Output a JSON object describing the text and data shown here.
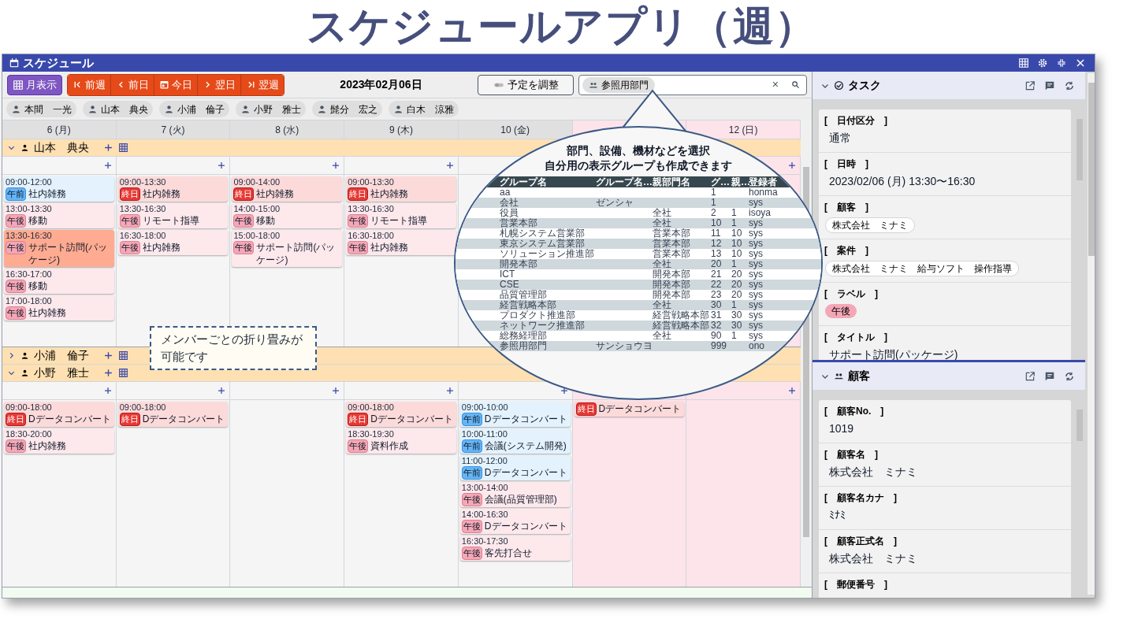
{
  "page_title": "スケジュールアプリ（週）",
  "window": {
    "title": "スケジュール"
  },
  "toolbar": {
    "month_button": "月表示",
    "nav_buttons": [
      {
        "label": "前週",
        "kind": "first"
      },
      {
        "label": "前日",
        "kind": "prev"
      },
      {
        "label": "今日",
        "kind": "today"
      },
      {
        "label": "翌日",
        "kind": "next"
      },
      {
        "label": "翌週",
        "kind": "last"
      }
    ],
    "date": "2023年02月06日",
    "adjust_button": "予定を調整",
    "search_chip": "参照用部門",
    "clear": "×"
  },
  "members": [
    "本間　一光",
    "山本　典央",
    "小浦　倫子",
    "小野　雅士",
    "髭分　宏之",
    "白木　涼雅"
  ],
  "days": [
    {
      "label": "6 (月)",
      "holiday": false
    },
    {
      "label": "7 (火)",
      "holiday": false
    },
    {
      "label": "8 (水)",
      "holiday": false
    },
    {
      "label": "9 (木)",
      "holiday": false
    },
    {
      "label": "10 (金)",
      "holiday": false
    },
    {
      "holiday": true
    },
    {
      "label": "12 (日)",
      "holiday": true
    }
  ],
  "groups": [
    {
      "name": "山本　典央",
      "expanded": true,
      "days": [
        {
          "holiday": false,
          "events": [
            {
              "time": "09:00-12:00",
              "label": "午前",
              "kind": "am",
              "title": "社内雑務",
              "selected": false
            },
            {
              "time": "13:00-13:30",
              "label": "午後",
              "kind": "pm",
              "title": "移動",
              "selected": false
            },
            {
              "time": "13:30-16:30",
              "label": "午後",
              "kind": "pm",
              "title": "サポート訪問(パッケージ)",
              "selected": true
            },
            {
              "time": "16:30-17:00",
              "label": "午後",
              "kind": "pm",
              "title": "移動",
              "selected": false
            },
            {
              "time": "17:00-18:00",
              "label": "午後",
              "kind": "pm",
              "title": "社内雑務",
              "selected": false
            }
          ]
        },
        {
          "holiday": false,
          "events": [
            {
              "time": "09:00-13:30",
              "label": "終日",
              "kind": "allday",
              "title": "社内雑務",
              "selected": false
            },
            {
              "time": "13:30-16:30",
              "label": "午後",
              "kind": "pm",
              "title": "リモート指導",
              "selected": false
            },
            {
              "time": "16:30-18:00",
              "label": "午後",
              "kind": "pm",
              "title": "社内雑務",
              "selected": false
            }
          ]
        },
        {
          "holiday": false,
          "events": [
            {
              "time": "09:00-14:00",
              "label": "終日",
              "kind": "allday",
              "title": "社内雑務",
              "selected": false
            },
            {
              "time": "14:00-15:00",
              "label": "午後",
              "kind": "pm",
              "title": "移動",
              "selected": false
            },
            {
              "time": "15:00-18:00",
              "label": "午後",
              "kind": "pm",
              "title": "サポート訪問(パッケージ)",
              "selected": false
            }
          ]
        },
        {
          "holiday": false,
          "events": [
            {
              "time": "09:00-13:30",
              "label": "終日",
              "kind": "allday",
              "title": "社内雑務",
              "selected": false
            },
            {
              "time": "13:30-16:30",
              "label": "午後",
              "kind": "pm",
              "title": "リモート指導",
              "selected": false
            },
            {
              "time": "16:30-18:00",
              "label": "午後",
              "kind": "pm",
              "title": "社内雑務",
              "selected": false
            }
          ]
        }
      ]
    },
    {
      "name": "小浦　倫子",
      "expanded": false
    },
    {
      "name": "小野　雅士",
      "expanded": true,
      "days": [
        {
          "holiday": false,
          "events": [
            {
              "time": "09:00-18:00",
              "label": "終日",
              "kind": "allday",
              "title": "Dデータコンバート",
              "selected": false
            },
            {
              "time": "18:30-20:00",
              "label": "午後",
              "kind": "pm",
              "title": "社内雑務",
              "selected": false
            }
          ]
        },
        {
          "holiday": false,
          "events": [
            {
              "time": "09:00-18:00",
              "label": "終日",
              "kind": "allday",
              "title": "Dデータコンバート",
              "selected": false
            }
          ]
        },
        {
          "holiday": false
        },
        {
          "holiday": false,
          "events": [
            {
              "time": "09:00-18:00",
              "label": "終日",
              "kind": "allday",
              "title": "Dデータコンバート",
              "selected": false
            },
            {
              "time": "18:30-19:30",
              "label": "午後",
              "kind": "pm",
              "title": "資料作成",
              "selected": false
            }
          ]
        },
        {
          "holiday": false,
          "events": [
            {
              "time": "09:00-10:00",
              "label": "午前",
              "kind": "am",
              "title": "Dデータコンバート",
              "selected": false
            },
            {
              "time": "10:00-11:00",
              "label": "午前",
              "kind": "am",
              "title": "会議(システム開発)",
              "selected": false
            },
            {
              "time": "11:00-12:00",
              "label": "午前",
              "kind": "am",
              "title": "Dデータコンバート",
              "selected": false
            },
            {
              "time": "13:00-14:00",
              "label": "午後",
              "kind": "pm",
              "title": "会議(品質管理部)",
              "selected": false
            },
            {
              "time": "14:00-16:30",
              "label": "午後",
              "kind": "pm",
              "title": "Dデータコンバート",
              "selected": false
            },
            {
              "time": "16:30-17:30",
              "label": "午後",
              "kind": "pm",
              "title": "客先打合せ",
              "selected": false
            }
          ]
        },
        {
          "holiday": true,
          "events": [
            {
              "label": "終日",
              "kind": "allday",
              "title": "Dデータコンバート",
              "selected": false
            }
          ]
        },
        {
          "holiday": true
        }
      ]
    }
  ],
  "note": "メンバーごとの折り畳みが可能です",
  "bubble": {
    "lines": [
      "部門、設備、機材などを選択",
      "自分用の表示グループも作成できます"
    ],
    "columns": [
      "グループ名",
      "グループ名…",
      "親部門名",
      "グ…",
      "親…",
      "登録者"
    ],
    "rows": [
      [
        "aa",
        "",
        "",
        "1",
        "",
        "honma"
      ],
      [
        "会社",
        "ゼンシャ",
        "",
        "1",
        "",
        "sys"
      ],
      [
        "役員",
        "",
        "全社",
        "2",
        "1",
        "isoya"
      ],
      [
        "営業本部",
        "",
        "全社",
        "10",
        "1",
        "sys"
      ],
      [
        "札幌システム営業部",
        "",
        "営業本部",
        "11",
        "10",
        "sys"
      ],
      [
        "東京システム営業部",
        "",
        "営業本部",
        "12",
        "10",
        "sys"
      ],
      [
        "ソリューション推進部",
        "",
        "営業本部",
        "13",
        "10",
        "sys"
      ],
      [
        "開発本部",
        "",
        "全社",
        "20",
        "1",
        "sys"
      ],
      [
        "ICT",
        "",
        "開発本部",
        "21",
        "20",
        "sys"
      ],
      [
        "CSE",
        "",
        "開発本部",
        "22",
        "20",
        "sys"
      ],
      [
        "品質管理部",
        "",
        "開発本部",
        "23",
        "20",
        "sys"
      ],
      [
        "経営戦略本部",
        "",
        "全社",
        "30",
        "1",
        "sys"
      ],
      [
        "プロダクト推進部",
        "",
        "経営戦略本部",
        "31",
        "30",
        "sys"
      ],
      [
        "ネットワーク推進部",
        "",
        "経営戦略本部",
        "32",
        "30",
        "sys"
      ],
      [
        "総務経理部",
        "",
        "全社",
        "90",
        "1",
        "sys"
      ],
      [
        "参照用部門",
        "サンショウヨ",
        "",
        "999",
        "",
        "ono"
      ]
    ]
  },
  "panels": [
    {
      "title": "タスク",
      "kind": "task",
      "fields": [
        {
          "label": "[　日付区分　]",
          "kind": "text",
          "value": "通常"
        },
        {
          "label": "[　日時　]",
          "kind": "text",
          "value": "2023/02/06 (月) 13:30〜16:30"
        },
        {
          "label": "[　顧客　]",
          "kind": "chip",
          "value": "株式会社　ミナミ"
        },
        {
          "label": "[　案件　]",
          "kind": "chip",
          "value": "株式会社　ミナミ　給与ソフト　操作指導"
        },
        {
          "label": "[　ラベル　]",
          "kind": "label",
          "value": "午後"
        },
        {
          "label": "[　タイトル　]",
          "kind": "text",
          "value": "サポート訪問(パッケージ)"
        }
      ]
    },
    {
      "title": "顧客",
      "kind": "people",
      "fields": [
        {
          "label": "[　顧客No.　]",
          "kind": "text",
          "value": "1019"
        },
        {
          "label": "[　顧客名　]",
          "kind": "text",
          "value": "株式会社　ミナミ"
        },
        {
          "label": "[　顧客名カナ　]",
          "kind": "text",
          "value": "ﾐﾅﾐ"
        },
        {
          "label": "[　顧客正式名　]",
          "kind": "text",
          "value": "株式会社　ミナミ"
        },
        {
          "label": "[　郵便番号　]"
        }
      ]
    }
  ]
}
